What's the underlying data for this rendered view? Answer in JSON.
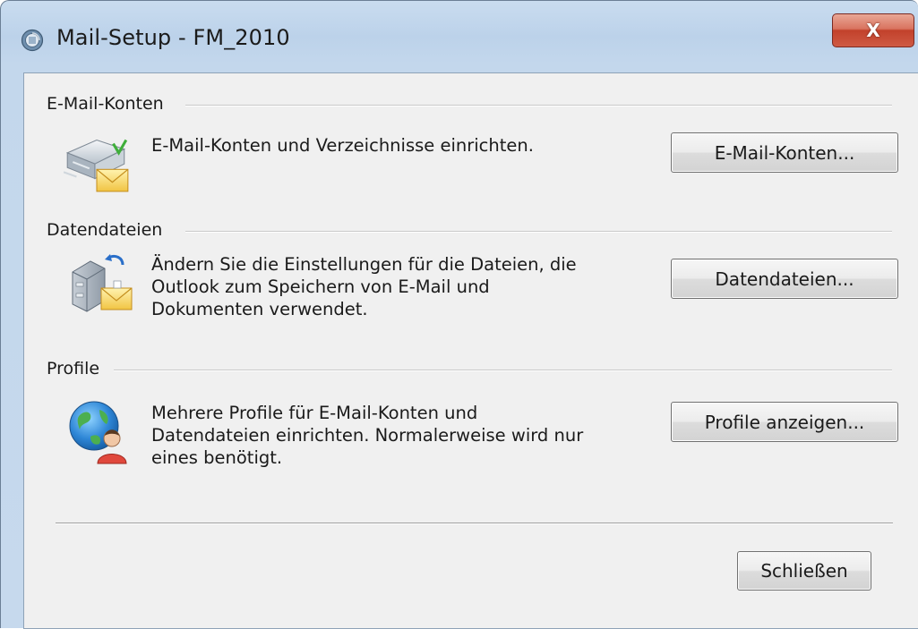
{
  "window": {
    "title": "Mail-Setup - FM_2010",
    "close_label": "X"
  },
  "sections": [
    {
      "label": "E-Mail-Konten",
      "icon": "mail-server-icon",
      "description": [
        "E-Mail-Konten und Verzeichnisse einrichten."
      ],
      "button_label": "E-Mail-Konten..."
    },
    {
      "label": "Datendateien",
      "icon": "data-files-icon",
      "description": [
        "Ändern Sie die Einstellungen für die Dateien, die",
        "Outlook zum Speichern von E-Mail und",
        "Dokumenten verwendet."
      ],
      "button_label": "Datendateien..."
    },
    {
      "label": "Profile",
      "icon": "profiles-globe-icon",
      "description": [
        "Mehrere Profile für E-Mail-Konten und",
        "Datendateien einrichten. Normalerweise wird nur",
        "eines benötigt."
      ],
      "button_label": "Profile anzeigen..."
    }
  ],
  "footer": {
    "close_button_label": "Schließen"
  }
}
